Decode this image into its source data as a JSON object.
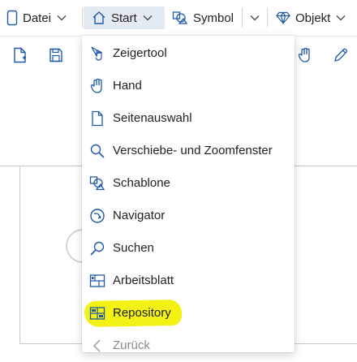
{
  "ribbon": {
    "tabs": [
      {
        "label": "Datei"
      },
      {
        "label": "Start"
      },
      {
        "label": "Symbol"
      },
      {
        "label": "Objekt"
      }
    ]
  },
  "menu": {
    "items": [
      {
        "label": "Zeigertool",
        "icon": "pointer-icon"
      },
      {
        "label": "Hand",
        "icon": "hand-icon"
      },
      {
        "label": "Seitenauswahl",
        "icon": "page-icon"
      },
      {
        "label": "Verschiebe- und Zoomfenster",
        "icon": "magnifier-icon"
      },
      {
        "label": "Schablone",
        "icon": "stencil-icon"
      },
      {
        "label": "Navigator",
        "icon": "navigator-icon"
      },
      {
        "label": "Suchen",
        "icon": "search-icon"
      },
      {
        "label": "Arbeitsblatt",
        "icon": "worksheet-icon"
      },
      {
        "label": "Repository",
        "icon": "repository-icon",
        "highlighted": true
      },
      {
        "label": "Zurück",
        "icon": "back-chevron-icon",
        "disabled": true
      }
    ]
  },
  "colors": {
    "accent": "#1e5aa8",
    "highlight": "#f3f214",
    "active_tab": "#e4eaf1"
  }
}
